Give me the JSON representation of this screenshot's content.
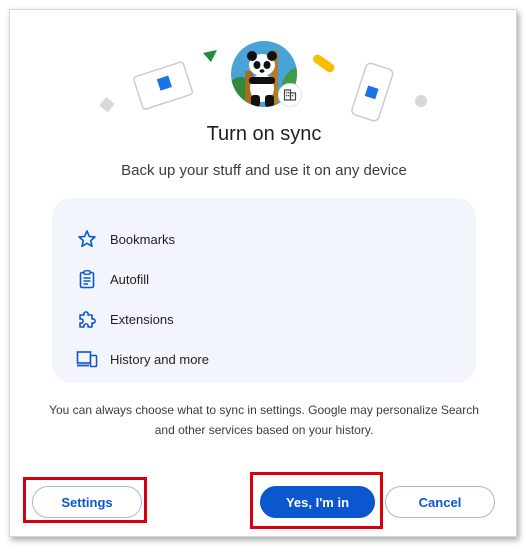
{
  "dialog": {
    "title": "Turn on sync",
    "subtitle": "Back up your stuff and use it on any device",
    "features": [
      {
        "label": "Bookmarks",
        "icon": "star-icon"
      },
      {
        "label": "Autofill",
        "icon": "clipboard-icon"
      },
      {
        "label": "Extensions",
        "icon": "puzzle-icon"
      },
      {
        "label": "History and more",
        "icon": "devices-icon"
      }
    ],
    "note": "You can always choose what to sync in settings. Google may personalize Search and other services based on your history.",
    "buttons": {
      "settings": "Settings",
      "confirm": "Yes, I'm in",
      "cancel": "Cancel"
    }
  },
  "colors": {
    "accent": "#0b57d0",
    "feature_box": "#f2f5fb",
    "highlight": "#d7000f"
  }
}
